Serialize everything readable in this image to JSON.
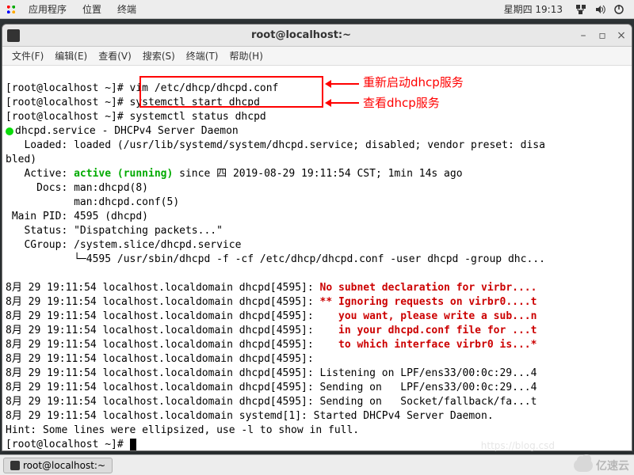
{
  "panel": {
    "apps": "应用程序",
    "places": "位置",
    "terminal": "终端",
    "datetime": "星期四 19:13"
  },
  "window": {
    "title": "root@localhost:~",
    "min": "–",
    "max": "▫",
    "close": "×"
  },
  "menu": {
    "file": "文件(F)",
    "edit": "编辑(E)",
    "view": "查看(V)",
    "search": "搜索(S)",
    "terminal": "终端(T)",
    "help": "帮助(H)"
  },
  "term": {
    "l1": "[root@localhost ~]# vim /etc/dhcp/dhcpd.conf",
    "l2": "[root@localhost ~]# systemctl start dhcpd",
    "l3": "[root@localhost ~]# systemctl status dhcpd",
    "l4a": "dhcpd.service - DHCPv4 Server Daemon",
    "l5": "   Loaded: loaded (/usr/lib/systemd/system/dhcpd.service; disabled; vendor preset: disa",
    "l5b": "bled)",
    "l6a": "   Active: ",
    "l6b": "active (running)",
    "l6c": " since 四 2019-08-29 19:11:54 CST; 1min 14s ago",
    "l7": "     Docs: man:dhcpd(8)",
    "l8": "           man:dhcpd.conf(5)",
    "l9": " Main PID: 4595 (dhcpd)",
    "l10": "   Status: \"Dispatching packets...\"",
    "l11": "   CGroup: /system.slice/dhcpd.service",
    "l12": "           └─4595 /usr/sbin/dhcpd -f -cf /etc/dhcp/dhcpd.conf -user dhcpd -group dhc...",
    "blank": "",
    "r1a": "8月 29 19:11:54 localhost.localdomain dhcpd[4595]: ",
    "r1b": "No subnet declaration for virbr....",
    "r2a": "8月 29 19:11:54 localhost.localdomain dhcpd[4595]: ",
    "r2b": "** Ignoring requests on virbr0....t",
    "r3a": "8月 29 19:11:54 localhost.localdomain dhcpd[4595]: ",
    "r3b": "   you want, please write a sub...n",
    "r4a": "8月 29 19:11:54 localhost.localdomain dhcpd[4595]: ",
    "r4b": "   in your dhcpd.conf file for ...t",
    "r5a": "8月 29 19:11:54 localhost.localdomain dhcpd[4595]: ",
    "r5b": "   to which interface virbr0 is...*",
    "r6": "8月 29 19:11:54 localhost.localdomain dhcpd[4595]: ",
    "r7": "8月 29 19:11:54 localhost.localdomain dhcpd[4595]: Listening on LPF/ens33/00:0c:29...4",
    "r8": "8月 29 19:11:54 localhost.localdomain dhcpd[4595]: Sending on   LPF/ens33/00:0c:29...4",
    "r9": "8月 29 19:11:54 localhost.localdomain dhcpd[4595]: Sending on   Socket/fallback/fa...t",
    "r10": "8月 29 19:11:54 localhost.localdomain systemd[1]: Started DHCPv4 Server Daemon.",
    "hint": "Hint: Some lines were ellipsized, use -l to show in full.",
    "prompt": "[root@localhost ~]# "
  },
  "annotations": {
    "a1": "重新启动dhcp服务",
    "a2": "查看dhcp服务"
  },
  "taskbar": {
    "item1": "root@localhost:~"
  },
  "watermark": {
    "text": "亿速云",
    "url": "https://blog.csd"
  }
}
